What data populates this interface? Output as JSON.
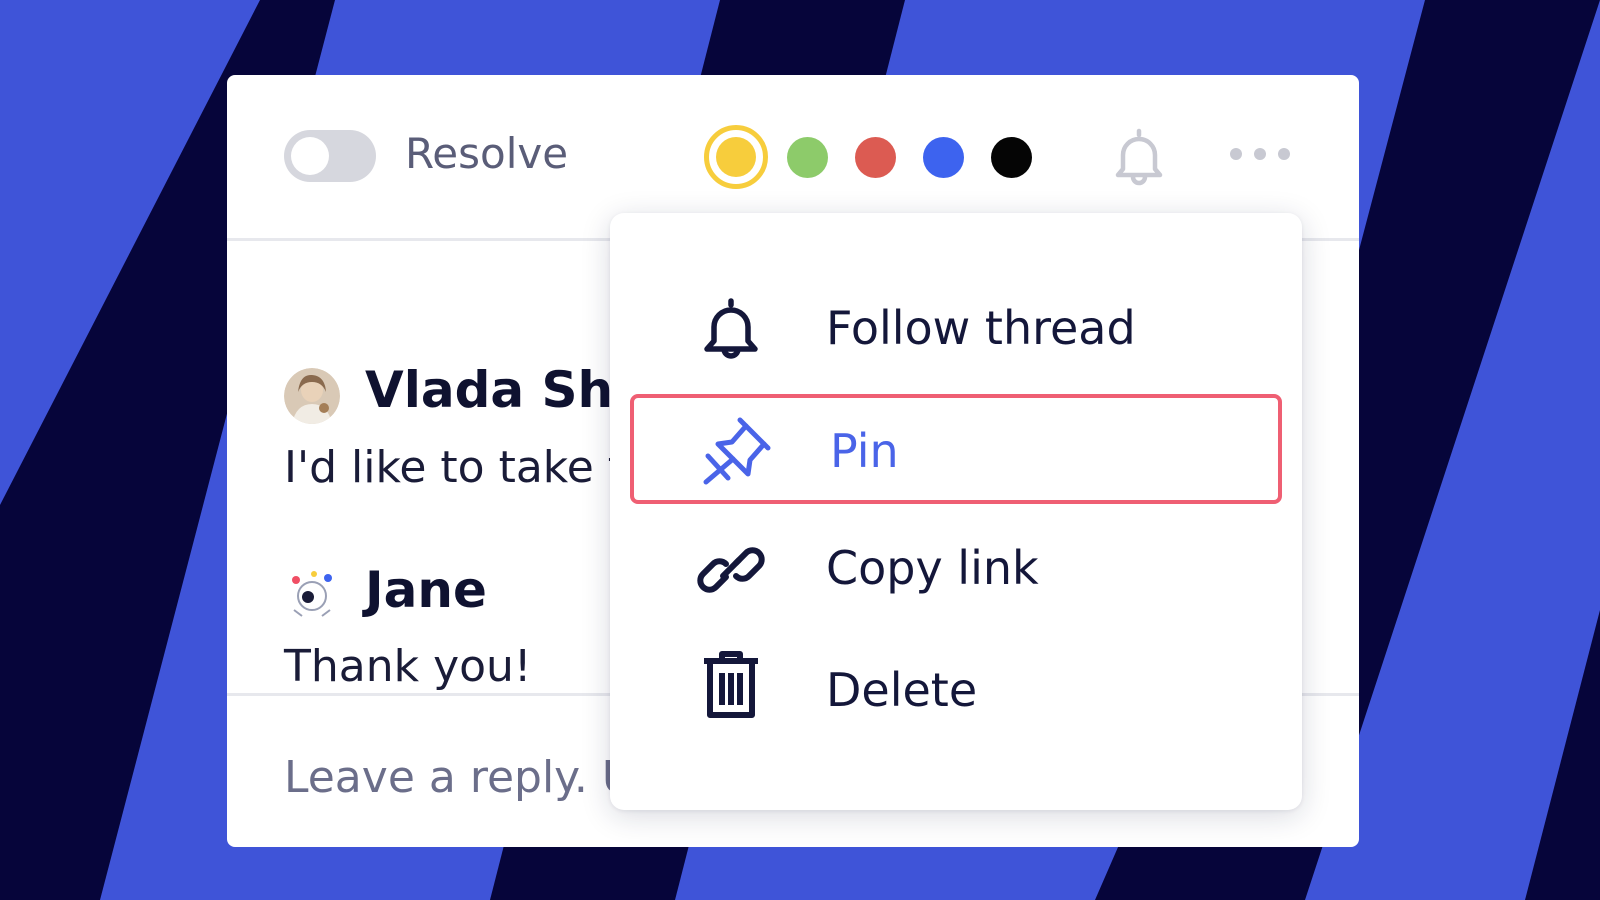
{
  "toolbar": {
    "resolve_label": "Resolve",
    "resolve_toggle_on": false,
    "color_options": [
      {
        "name": "yellow",
        "hex": "#f7cd3c",
        "selected": true
      },
      {
        "name": "green",
        "hex": "#8dcb6a",
        "selected": false
      },
      {
        "name": "red",
        "hex": "#dc5b52",
        "selected": false
      },
      {
        "name": "blue",
        "hex": "#3d63ef",
        "selected": false
      },
      {
        "name": "black",
        "hex": "#050505",
        "selected": false
      }
    ],
    "notification_icon": "bell-icon",
    "more_icon": "more-horizontal-icon"
  },
  "thread": {
    "comments": [
      {
        "author": "Vlada Shi",
        "text": "I'd like to take t"
      },
      {
        "author": "Jane",
        "text": "Thank you!"
      }
    ]
  },
  "reply": {
    "placeholder": "Leave a reply. U"
  },
  "menu": {
    "items": [
      {
        "label": "Follow thread",
        "icon": "bell-icon",
        "highlighted": false
      },
      {
        "label": "Pin",
        "icon": "pin-icon",
        "highlighted": true
      },
      {
        "label": "Copy link",
        "icon": "link-icon",
        "highlighted": false
      },
      {
        "label": "Delete",
        "icon": "trash-icon",
        "highlighted": false
      }
    ]
  },
  "colors": {
    "background": "#3f54d8",
    "stripe": "#06053a",
    "accent_blue": "#4a64e8",
    "highlight_border": "#ef5f73"
  }
}
